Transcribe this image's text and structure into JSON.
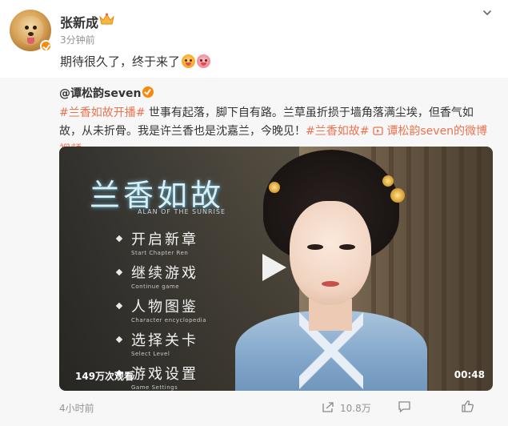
{
  "post": {
    "username": "张新成",
    "time_ago": "3分钟前",
    "text": "期待很久了，终于来了",
    "emojis": [
      "doge-emoji",
      "pig-emoji"
    ]
  },
  "repost": {
    "author": "@谭松韵seven",
    "hashtag1": "#兰香如故开播#",
    "text_part1": " 世事有起落，脚下自有路。兰草虽折损于墙角落满尘埃，但香气如故，从未折骨。我是许兰香也是沈嘉兰，今晚见！",
    "hashtag2": "#兰香如故#",
    "video_link": "谭松韵seven的微博视频",
    "video": {
      "title": "兰香如故",
      "subtitle": "ALAN OF THE SUNRISE",
      "menu": [
        {
          "zh": "开启新章",
          "en": "Start Chapter Ren"
        },
        {
          "zh": "继续游戏",
          "en": "Continue game"
        },
        {
          "zh": "人物图鉴",
          "en": "Character encyclopedia"
        },
        {
          "zh": "选择关卡",
          "en": "Select Level"
        },
        {
          "zh": "游戏设置",
          "en": "Game Settings"
        }
      ],
      "view_count": "149万次观看",
      "duration": "00:48"
    },
    "footer": {
      "time": "4小时前",
      "share_count": "10.8万"
    }
  },
  "colors": {
    "link": "#eb7350",
    "verified_badge": "#f78a0b",
    "meta_gray": "#939393"
  }
}
